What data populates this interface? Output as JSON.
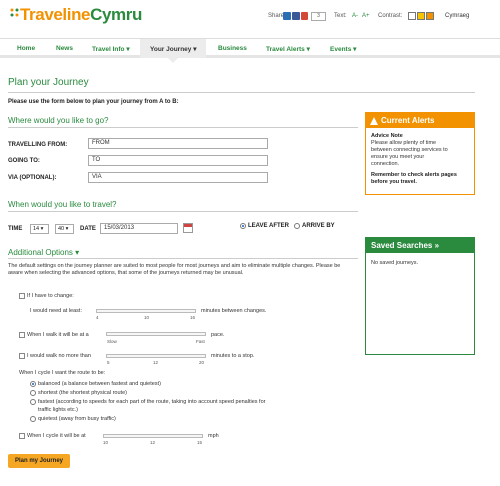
{
  "header": {
    "logo_part1": "Traveline",
    "logo_part2": "Cymru",
    "share_label": "Share",
    "share_count": "3",
    "text_label": "Text:",
    "text_smaller": "A-",
    "text_larger": "A+",
    "contrast_label": "Contrast:",
    "contrast_colors": [
      "#ffffff",
      "#f5c400",
      "#f39200"
    ],
    "language_link": "Cymraeg",
    "share_icons": [
      "linkedin-icon",
      "facebook-icon",
      "google-plus-icon"
    ]
  },
  "nav": {
    "items": [
      "Home",
      "News",
      "Travel Info ▾",
      "Your Journey ▾",
      "Business",
      "Travel Alerts ▾",
      "Events ▾"
    ],
    "active_index": 3
  },
  "main": {
    "title": "Plan your Journey",
    "intro": "Please use the form below to plan your journey from A to B:",
    "where_heading": "Where would you like to go?",
    "from_label": "TRAVELLING FROM:",
    "from_value": "FROM",
    "to_label": "GOING TO:",
    "to_value": "TO",
    "via_label": "VIA (OPTIONAL):",
    "via_value": "VIA",
    "when_heading": "When would you like to travel?",
    "time_label": "TIME",
    "hour_value": "14 ▾",
    "minute_value": "40 ▾",
    "date_label": "DATE",
    "date_value": "15/03/2013",
    "leave_after": "LEAVE AFTER",
    "arrive_by": "ARRIVE BY",
    "additional_heading": "Additional Options ▾",
    "additional_para": "The default settings on the journey planner are suited to most people for most journeys and aim to eliminate multiple changes. Please be aware when selecting the advanced options, that some of the journeys returned may be unusual.",
    "if_i_have_to_change": "If I have to change:",
    "need_at_least": "I would need at least:",
    "between_changes": "minutes between changes.",
    "change_ticks": [
      "4",
      "10",
      "16"
    ],
    "walk_pace_label": "When I walk it will be at a",
    "pace_suffix": "pace.",
    "pace_ticks": [
      "Slow",
      "Fast"
    ],
    "walk_max_label": "I would walk no more than",
    "walk_max_suffix": "minutes to a stop.",
    "walk_ticks": [
      "5",
      "12",
      "20"
    ],
    "cycle_route_label": "When I cycle I want the route to be:",
    "cycle_options": [
      "balanced (a balance between fastest and quietest)",
      "shortest (the shortest physical route)",
      "fastest (according to speeds for each part of the route, taking into account speed penalties for",
      "traffic lights etc.)",
      "quietest (away from busy traffic)"
    ],
    "cycle_speed_label": "When I cycle it will be at",
    "cycle_speed_suffix": "mph",
    "cycle_ticks": [
      "10",
      "12",
      "15"
    ],
    "submit": "Plan my Journey"
  },
  "alerts": {
    "title": "Current Alerts",
    "advice_title": "Advice Note",
    "advice_text": [
      "Please allow plenty of time",
      "between connecting services to",
      "ensure you meet your",
      "connection."
    ],
    "reminder": [
      "Remember to check alerts pages",
      "before you travel."
    ]
  },
  "saved": {
    "title": "Saved Searches »",
    "empty": "No saved journeys."
  }
}
